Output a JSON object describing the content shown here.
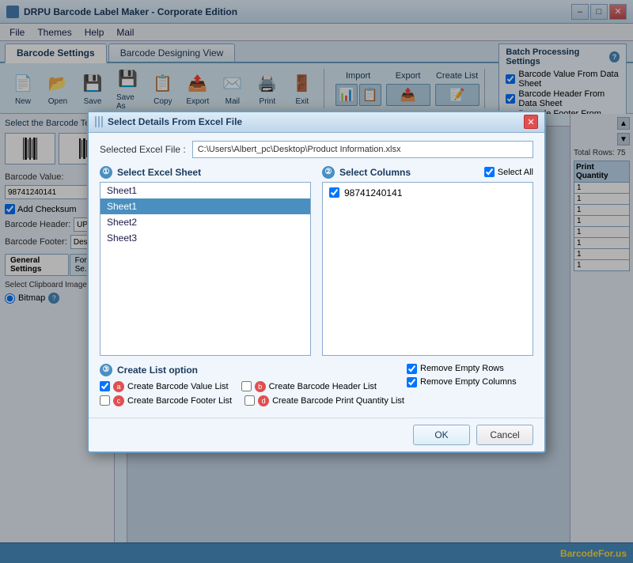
{
  "app": {
    "title": "DRPU Barcode Label Maker - Corporate Edition",
    "icon": "barcode-app-icon"
  },
  "title_controls": {
    "minimize": "–",
    "maximize": "□",
    "close": "✕"
  },
  "menu": {
    "items": [
      "File",
      "Themes",
      "Help",
      "Mail"
    ]
  },
  "tabs": {
    "items": [
      "Barcode Settings",
      "Barcode Designing View"
    ],
    "active": 0
  },
  "toolbar": {
    "buttons": [
      {
        "label": "New",
        "icon": "📄"
      },
      {
        "label": "Open",
        "icon": "📂"
      },
      {
        "label": "Save",
        "icon": "💾"
      },
      {
        "label": "Save As",
        "icon": "💾"
      },
      {
        "label": "Copy",
        "icon": "📋"
      },
      {
        "label": "Export",
        "icon": "📤"
      },
      {
        "label": "Mail",
        "icon": "✉️"
      },
      {
        "label": "Print",
        "icon": "🖨️"
      },
      {
        "label": "Exit",
        "icon": "🚪"
      }
    ],
    "import_label": "Import",
    "export_label": "Export",
    "create_list_label": "Create List"
  },
  "batch_settings": {
    "title": "Batch Processing Settings",
    "help_icon": "?",
    "options": [
      {
        "label": "Barcode Value From Data Sheet",
        "checked": true
      },
      {
        "label": "Barcode Header From Data Sheet",
        "checked": true
      },
      {
        "label": "Barcode Footer From Data Sheet",
        "checked": true
      }
    ]
  },
  "left_panel": {
    "select_label": "Select the Barcode Tec",
    "barcode_value_label": "Barcode Value:",
    "barcode_value": "98741240141",
    "add_checksum_label": "Add Checksum",
    "add_checksum_checked": true,
    "barcode_header_label": "Barcode Header:",
    "barcode_header_value": "UPCA Barca",
    "barcode_footer_label": "Barcode Footer:",
    "barcode_footer_value": "Designed us",
    "tabs": [
      "General Settings",
      "Font Se"
    ],
    "clipboard_label": "Select Clipboard Image T",
    "bitmap_label": "Bitmap",
    "help_icon": "?"
  },
  "right_sidebar": {
    "total_rows_label": "Total Rows: 75",
    "print_quantity_label": "Print Quantity",
    "rows": [
      "1",
      "1",
      "1",
      "1",
      "1",
      "1",
      "1",
      "1"
    ]
  },
  "modal": {
    "title": "Select Details From Excel File",
    "selected_excel_label": "Selected Excel File :",
    "selected_excel_value": "C:\\Users\\Albert_pc\\Desktop\\Product Information.xlsx",
    "select_sheet_label": "Select Excel Sheet",
    "step1": "①",
    "select_columns_label": "Select  Columns",
    "step2": "②",
    "select_all_label": "Select All",
    "select_all_checked": true,
    "sheets": [
      {
        "name": "Sheet1",
        "selected": false
      },
      {
        "name": "Sheet1",
        "selected": true
      },
      {
        "name": "Sheet2",
        "selected": false
      },
      {
        "name": "Sheet3",
        "selected": false
      }
    ],
    "columns": [
      {
        "name": "98741240141",
        "checked": true
      }
    ],
    "create_list_label": "Create List option",
    "step3": "③",
    "create_list_options": [
      {
        "label": "Create Barcode Value List",
        "checked": true,
        "circle": "a"
      },
      {
        "label": "Create Barcode Header List",
        "checked": false,
        "circle": "b"
      },
      {
        "label": "Create Barcode Footer List",
        "checked": false,
        "circle": "c"
      },
      {
        "label": "Create Barcode Print Quantity List",
        "checked": false,
        "circle": "d"
      }
    ],
    "remove_options": [
      {
        "label": "Remove Empty Rows",
        "checked": true
      },
      {
        "label": "Remove Empty Columns",
        "checked": true
      }
    ],
    "ok_label": "OK",
    "cancel_label": "Cancel"
  },
  "status_bar": {
    "brand_text": "BarcodeFor",
    "brand_suffix": ".us"
  }
}
